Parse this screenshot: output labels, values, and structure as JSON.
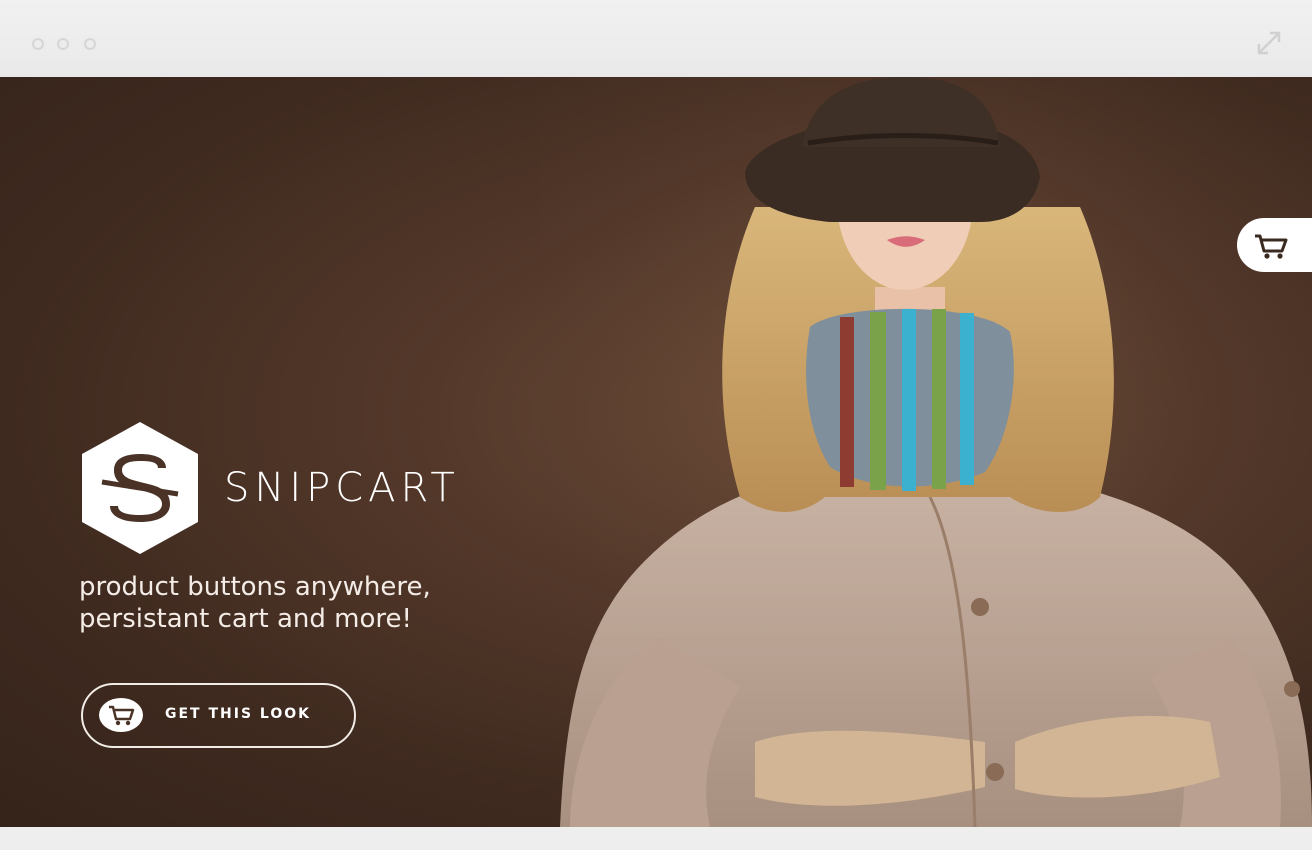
{
  "window": {
    "controls": [
      "close",
      "minimize",
      "maximize"
    ],
    "expand_icon": "expand-icon"
  },
  "brand": {
    "name": "SNIPCART",
    "logo_icon": "snipcart-logo-icon"
  },
  "hero": {
    "tagline_line1": "product buttons anywhere,",
    "tagline_line2": "persistant cart and more!",
    "image": "woman-in-hat-and-coat-photo"
  },
  "cta": {
    "label": "GET THIS LOOK",
    "icon": "shopping-cart-icon"
  },
  "cart_tab": {
    "icon": "shopping-cart-icon"
  },
  "colors": {
    "background": "#4a3226",
    "accent_text": "#ffffff",
    "chrome": "#eeeeee"
  }
}
